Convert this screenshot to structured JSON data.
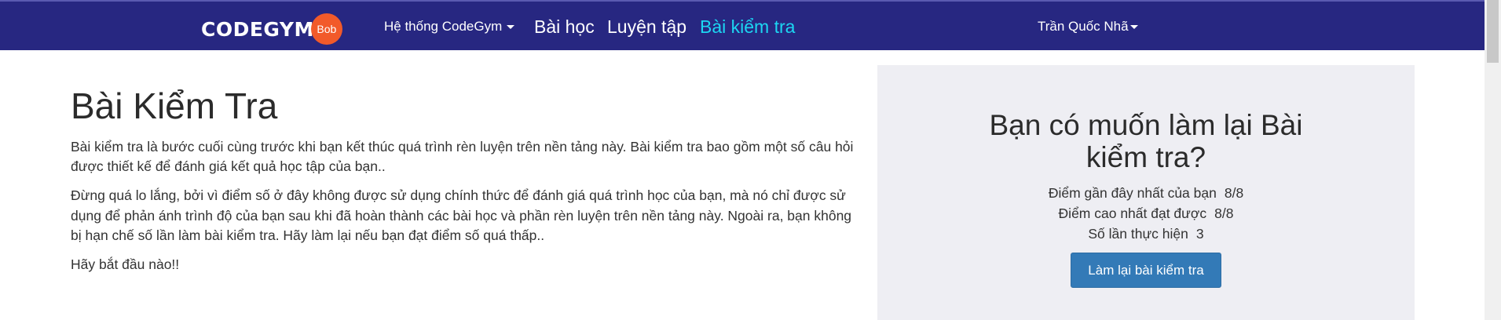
{
  "navbar": {
    "logo_text": "CODEGYM",
    "logo_badge": "Bob",
    "system_menu_label": "Hệ thống CodeGym",
    "lessons_label": "Bài học",
    "practice_label": "Luyện tập",
    "tests_label": "Bài kiểm tra",
    "user_name": "Trần Quốc Nhã",
    "colors": {
      "background": "#272781",
      "active": "#1cd6f2",
      "logo_badge": "#f25a2a"
    }
  },
  "main": {
    "title": "Bài Kiểm Tra",
    "paragraphs": [
      "Bài kiểm tra là bước cuối cùng trước khi bạn kết thúc quá trình rèn luyện trên nền tảng này. Bài kiểm tra bao gồm một số câu hỏi được thiết kế để đánh giá kết quả học tập của bạn..",
      "Đừng quá lo lắng, bởi vì điểm số ở đây không được sử dụng chính thức để đánh giá quá trình học của bạn, mà nó chỉ được sử dụng để phản ánh trình độ của bạn sau khi đã hoàn thành các bài học và phần rèn luyện trên nền tảng này. Ngoài ra, bạn không bị hạn chế số lần làm bài kiểm tra. Hãy làm lại nếu bạn đạt điểm số quá thấp..",
      "Hãy bắt đầu nào!!"
    ]
  },
  "panel": {
    "title": "Bạn có muốn làm lại Bài kiểm tra?",
    "stats": [
      {
        "label": "Điểm gần đây nhất của bạn",
        "value": "8/8"
      },
      {
        "label": "Điểm cao nhất đạt được",
        "value": "8/8"
      },
      {
        "label": "Số lần thực hiện",
        "value": "3"
      }
    ],
    "retry_button": "Làm lại bài kiểm tra",
    "colors": {
      "background": "#eeeef3",
      "button": "#337ab7"
    }
  }
}
